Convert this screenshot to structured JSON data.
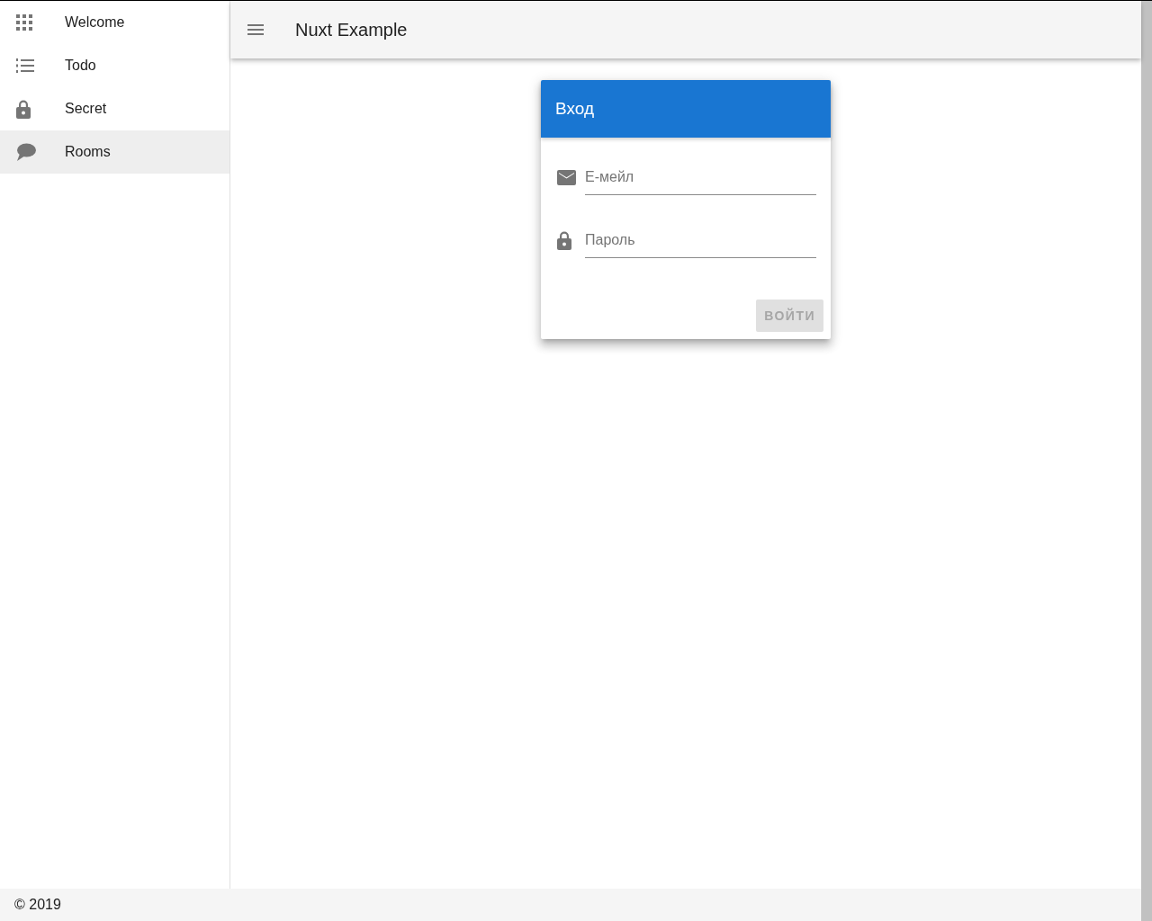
{
  "sidebar": {
    "items": [
      {
        "label": "Welcome",
        "kind": "apps",
        "selected": false
      },
      {
        "label": "Todo",
        "kind": "list",
        "selected": false
      },
      {
        "label": "Secret",
        "kind": "lock",
        "selected": false
      },
      {
        "label": "Rooms",
        "kind": "chat",
        "selected": true
      }
    ]
  },
  "toolbar": {
    "title": "Nuxt Example"
  },
  "login_card": {
    "title": "Вход",
    "fields": [
      {
        "kind": "email",
        "placeholder": "Е-мейл"
      },
      {
        "kind": "password",
        "placeholder": "Пароль"
      }
    ],
    "button": {
      "label": "ВОЙТИ",
      "disabled": true
    }
  },
  "footer": {
    "text": "© 2019"
  }
}
